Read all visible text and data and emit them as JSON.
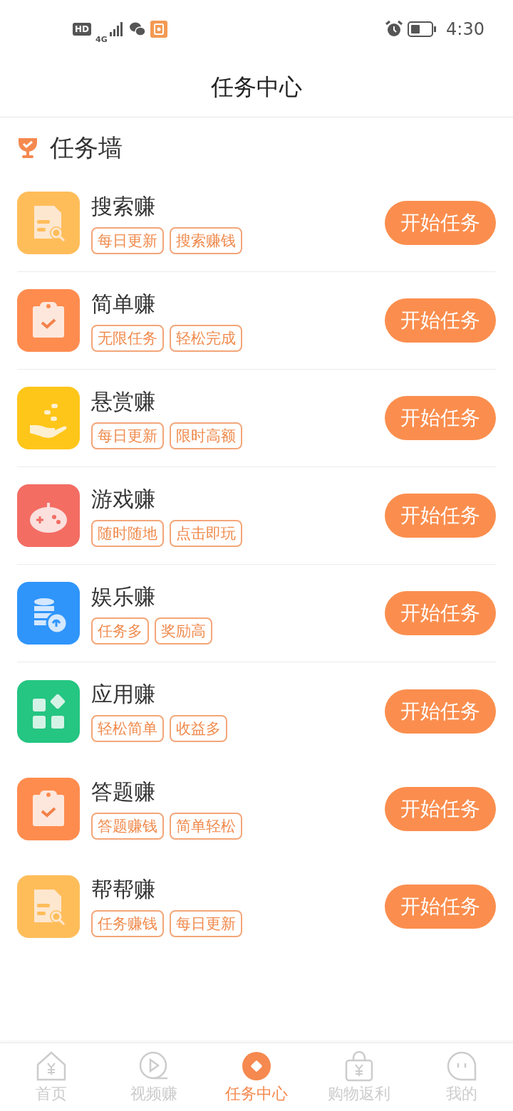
{
  "status_bar": {
    "network_badge": "HD",
    "network_type": "4G",
    "time": "4:30"
  },
  "header": {
    "title": "任务中心"
  },
  "section": {
    "title": "任务墙"
  },
  "tasks": [
    {
      "name": "搜索赚",
      "kind": "search",
      "color": "#ffbd5a",
      "tags": [
        "每日更新",
        "搜索赚钱"
      ],
      "button": "开始任务",
      "divider": true
    },
    {
      "name": "简单赚",
      "kind": "clipboard",
      "color": "#ff8c4f",
      "tags": [
        "无限任务",
        "轻松完成"
      ],
      "button": "开始任务",
      "divider": true
    },
    {
      "name": "悬赏赚",
      "kind": "hand",
      "color": "#ffc61a",
      "tags": [
        "每日更新",
        "限时高额"
      ],
      "button": "开始任务",
      "divider": true
    },
    {
      "name": "游戏赚",
      "kind": "game",
      "color": "#f36d63",
      "tags": [
        "随时随地",
        "点击即玩"
      ],
      "button": "开始任务",
      "divider": true
    },
    {
      "name": "娱乐赚",
      "kind": "coins",
      "color": "#2f95fb",
      "tags": [
        "任务多",
        "奖励高"
      ],
      "button": "开始任务",
      "divider": true
    },
    {
      "name": "应用赚",
      "kind": "apps",
      "color": "#25c582",
      "tags": [
        "轻松简单",
        "收益多"
      ],
      "button": "开始任务",
      "divider": false
    },
    {
      "name": "答题赚",
      "kind": "clipboard",
      "color": "#ff8c4f",
      "tags": [
        "答题赚钱",
        "简单轻松"
      ],
      "button": "开始任务",
      "divider": false
    },
    {
      "name": "帮帮赚",
      "kind": "search",
      "color": "#ffbd5a",
      "tags": [
        "任务赚钱",
        "每日更新"
      ],
      "button": "开始任务",
      "divider": false
    }
  ],
  "tab_bar": [
    {
      "label": "首页",
      "kind": "home",
      "selected": false
    },
    {
      "label": "视频赚",
      "kind": "video",
      "selected": false
    },
    {
      "label": "任务中心",
      "kind": "task",
      "selected": true
    },
    {
      "label": "购物返利",
      "kind": "shop",
      "selected": false
    },
    {
      "label": "我的",
      "kind": "me",
      "selected": false
    }
  ]
}
